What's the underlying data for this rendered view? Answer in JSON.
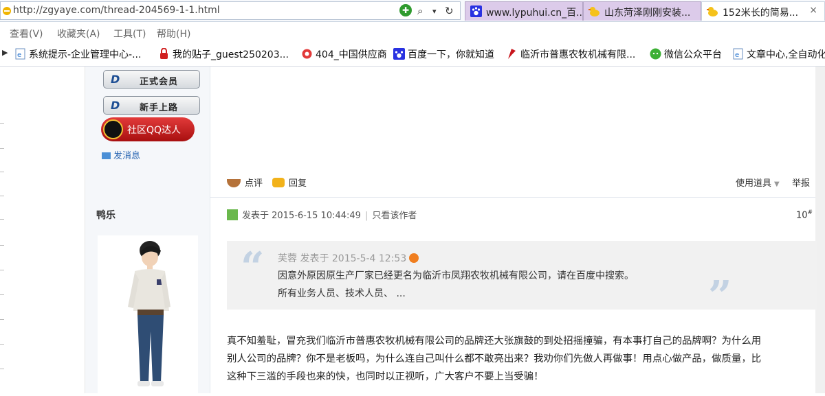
{
  "browser": {
    "url": "http://zgyaye.com/thread-204569-1-1.html",
    "tabs": [
      {
        "label": "www.lypuhui.cn_百...",
        "active": false
      },
      {
        "label": "山东菏泽刚刚安装...",
        "active": false
      },
      {
        "label": "152米长的简易...",
        "active": true
      }
    ],
    "close_glyph": "×",
    "menu": [
      "查看(V)",
      "收藏夹(A)",
      "工具(T)",
      "帮助(H)"
    ],
    "favorites": [
      "系统提示-企业管理中心-...",
      "我的贴子_guest250203...",
      "404_中国供应商",
      "百度一下，你就知道",
      "临沂市普惠农牧机械有限...",
      "微信公众平台",
      "文章中心,全自动化"
    ]
  },
  "sidebar": {
    "badges": [
      "正式会员",
      "新手上路"
    ],
    "qq_badge": "社区QQ达人",
    "send_message": "发消息",
    "author_name": "鸭乐"
  },
  "actions": {
    "comment": "点评",
    "reply": "回复",
    "tools": "使用道具",
    "report": "举报"
  },
  "post": {
    "posted_at": "发表于 2015-6-15 10:44:49",
    "only_author": "只看该作者",
    "floor": "10",
    "floor_mark": "#",
    "quote": {
      "header": "芙蓉 发表于 2015-5-4 12:53",
      "line1": "因意外原因原生产厂家已经更名为临沂市凤翔农牧机械有限公司，请在百度中搜索。",
      "line2": "所有业务人员、技术人员、 ..."
    },
    "body_lines": [
      "真不知羞耻，冒充我们临沂市普惠农牧机械有限公司的品牌还大张旗鼓的到处招摇撞骗，有本事打自己的品牌啊？为什么用",
      "别人公司的品牌？你不是老板吗，为什么连自己叫什么都不敢亮出来？我劝你们先做人再做事！用点心做产品，做质量，比",
      "这种下三滥的手段也来的快，也同时以正视听，广大客户不要上当受骗！"
    ]
  }
}
